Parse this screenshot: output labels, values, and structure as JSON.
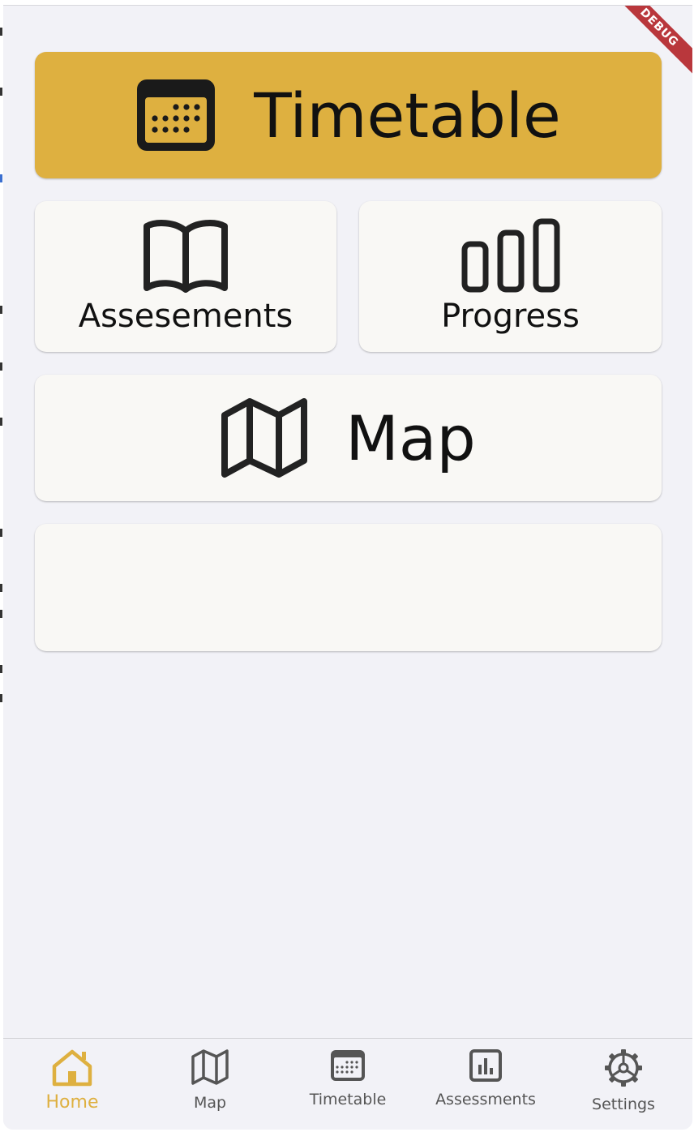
{
  "debug_banner": "DEBUG",
  "colors": {
    "accent": "#deb040",
    "card": "#f9f8f5",
    "background": "#f2f2f7",
    "icon": "#222222",
    "nav_inactive": "#555555"
  },
  "cards": {
    "timetable": {
      "label": "Timetable",
      "icon": "calendar-icon"
    },
    "assessments": {
      "label": "Assesements",
      "icon": "book-icon"
    },
    "progress": {
      "label": "Progress",
      "icon": "bar-chart-icon"
    },
    "map": {
      "label": "Map",
      "icon": "map-icon"
    }
  },
  "bottom_nav": {
    "active": "home",
    "items": [
      {
        "label": "Home",
        "icon": "home-icon"
      },
      {
        "label": "Map",
        "icon": "map-icon"
      },
      {
        "label": "Timetable",
        "icon": "calendar-icon"
      },
      {
        "label": "Assessments",
        "icon": "chart-icon"
      },
      {
        "label": "Settings",
        "icon": "gear-icon"
      }
    ]
  }
}
